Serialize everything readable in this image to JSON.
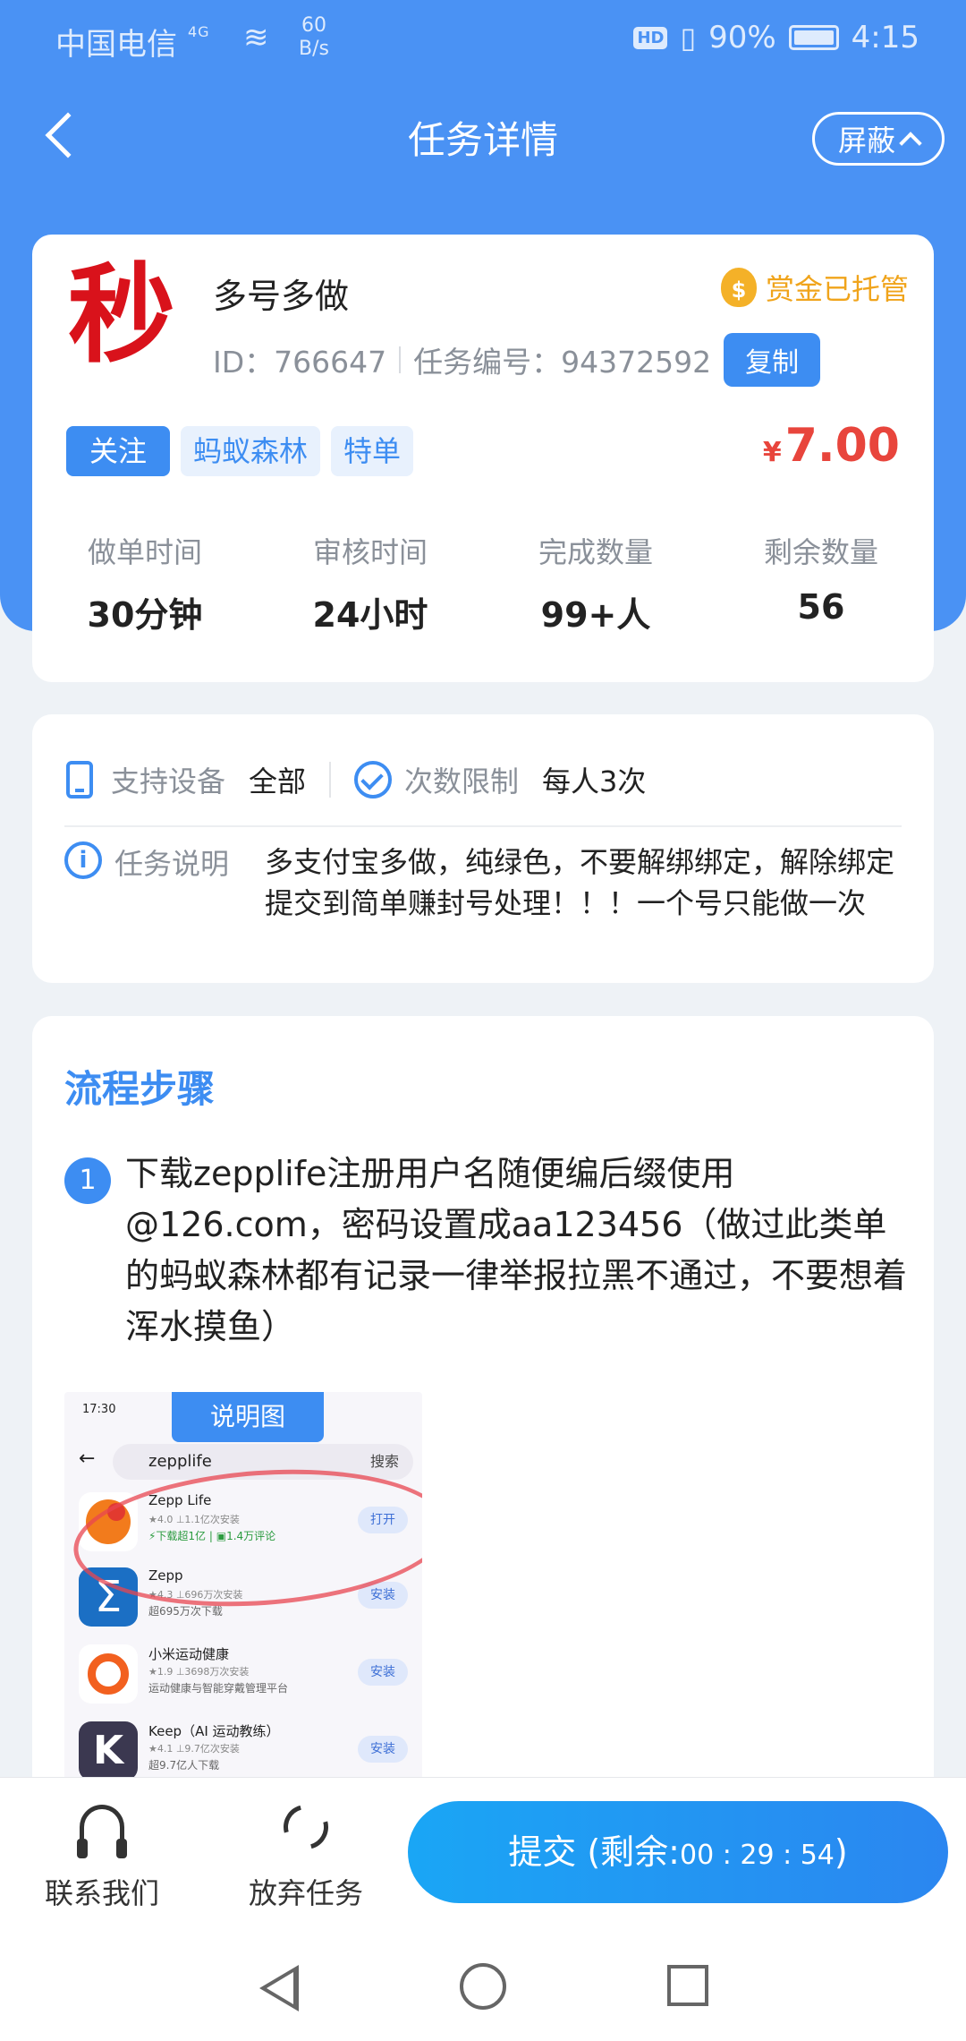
{
  "status_bar": {
    "carrier": "中国电信",
    "signal": "4G",
    "speed_value": "60",
    "speed_unit": "B/s",
    "hd": "HD",
    "battery": "90%",
    "time": "4:15"
  },
  "header": {
    "title": "任务详情",
    "shield_label": "屏蔽"
  },
  "task": {
    "logo_char": "秒",
    "name": "多号多做",
    "id_text": "ID：766647",
    "number_text": "任务编号：94372592",
    "copy_label": "复制",
    "escrow_label": "赏金已托管",
    "escrow_icon": "$",
    "tags": [
      "关注",
      "蚂蚁森林",
      "特单"
    ],
    "currency": "¥",
    "price": "7.00",
    "stats": [
      {
        "label": "做单时间",
        "value": "30分钟"
      },
      {
        "label": "审核时间",
        "value": "24小时"
      },
      {
        "label": "完成数量",
        "value": "99+人"
      },
      {
        "label": "剩余数量",
        "value": "56"
      }
    ]
  },
  "info": {
    "device_label": "支持设备",
    "device_value": "全部",
    "limit_label": "次数限制",
    "limit_value": "每人3次",
    "desc_label": "任务说明",
    "desc_value": "多支付宝多做，纯绿色，不要解绑绑定，解除绑定提交到简单赚封号处理！！！一个号只能做一次"
  },
  "steps": {
    "title": "流程步骤",
    "items": [
      {
        "num": "1",
        "text": "下载zepplife注册用户名随便编后缀使用@126.com，密码设置成aa123456（做过此类单的蚂蚁森林都有记录一律举报拉黑不通过，不要想着浑水摸鱼）"
      }
    ],
    "image_tag": "说明图",
    "image": {
      "status": "17:30",
      "search_text": "zepplife",
      "search_btn": "搜索",
      "apps": [
        {
          "name": "Zepp Life",
          "meta": "★4.0  ⊥1.1亿次安装",
          "desc": "⚡下载超1亿 | ▣1.4万评论",
          "btn": "打开"
        },
        {
          "name": "Zepp",
          "meta": "★4.3  ⊥696万次安装",
          "desc": "超695万次下载",
          "btn": "安装"
        },
        {
          "name": "小米运动健康",
          "meta": "★1.9  ⊥3698万次安装",
          "desc": "运动健康与智能穿戴管理平台",
          "btn": "安装"
        },
        {
          "name": "Keep（AI 运动教练）",
          "meta": "★4.1  ⊥9.7亿次安装",
          "desc": "超9.7亿人下载",
          "btn": "安装"
        }
      ]
    }
  },
  "bottom": {
    "contact_label": "联系我们",
    "abandon_label": "放弃任务",
    "submit_prefix": "提交 (剩余:",
    "countdown": "00 : 29 : 54",
    "submit_suffix": ")"
  },
  "colors": {
    "primary": "#4a92f4",
    "price": "#e8453c",
    "escrow": "#f0a41b"
  }
}
